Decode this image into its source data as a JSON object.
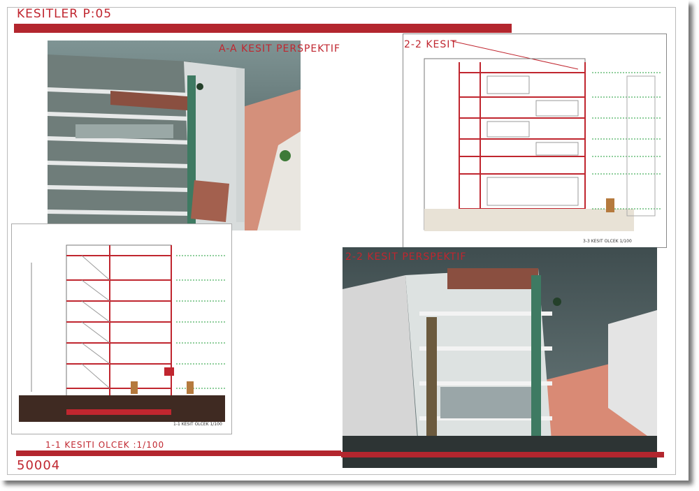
{
  "sheet": {
    "title": "KESITLER P:05",
    "sheet_code": "50004"
  },
  "labels": {
    "aa_perspective": "A-A KESIT PERSPEKTIF",
    "section_22": "2-2 KESIT",
    "section_22_scale": "3-3 KESIT OLCEK 1/100",
    "perspective_22": "2-2 KESIT PERSPEKTIF",
    "section_11_scale_small": "1-1 KESIT OLCEK 1/100",
    "section_11_scale": "1-1 KESITI OLCEK :1/100"
  },
  "colors": {
    "accent_red": "#b3262e",
    "sky": "#3b4a4a",
    "terrace": "#d98a75"
  }
}
